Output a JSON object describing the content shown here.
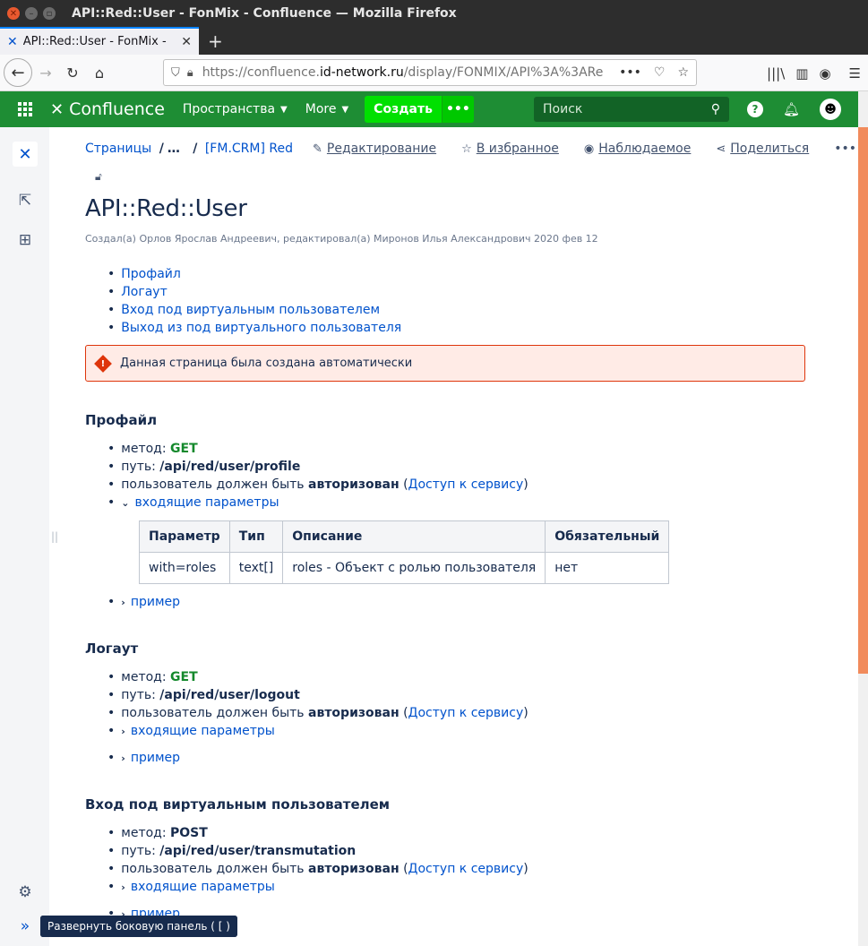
{
  "browser": {
    "window_title": "API::Red::User - FonMix - Confluence — Mozilla Firefox",
    "tab_title": "API::Red::User - FonMix - ",
    "url_prefix": "https://confluence.",
    "url_domain": "id-network.ru",
    "url_rest": "/display/FONMIX/API%3A%3ARe"
  },
  "header": {
    "logo_text": "Confluence",
    "spaces_label": "Пространства",
    "more_label": "More",
    "create_label": "Создать",
    "create_more": "•••",
    "search_placeholder": "Поиск",
    "help_icon": "?"
  },
  "breadcrumb": {
    "root": "Страницы",
    "ellipsis": "…",
    "parent": "[FM.CRM] Red"
  },
  "actions": {
    "edit": "Редактирование",
    "favorite": "В избранное",
    "watch": "Наблюдаемое",
    "share": "Поделиться",
    "more": "•••"
  },
  "page": {
    "title": "API::Red::User",
    "byline": "Создал(а) Орлов Ярослав Андреевич, редактировал(а) Миронов Илья Александрович 2020 фев 12",
    "toc": [
      "Профайл",
      "Логаут",
      "Вход под виртуальным пользователем",
      "Выход из под виртуального пользователя"
    ],
    "alert": "Данная страница была создана автоматически"
  },
  "labels": {
    "method": "метод:",
    "path": "путь:",
    "auth_prefix": "пользователь должен быть",
    "auth_bold": "авторизован",
    "auth_link": "Доступ к сервису",
    "params": "входящие параметры",
    "example": "пример"
  },
  "sections": [
    {
      "title": "Профайл",
      "method": "GET",
      "path": "/api/red/user/profile"
    },
    {
      "title": "Логаут",
      "method": "GET",
      "path": "/api/red/user/logout"
    },
    {
      "title": "Вход под виртуальным пользователем",
      "method": "POST",
      "path": "/api/red/user/transmutation"
    }
  ],
  "params_table": {
    "headers": [
      "Параметр",
      "Тип",
      "Описание",
      "Обязательный"
    ],
    "row": [
      "with=roles",
      "text[]",
      "roles - Объект с ролью пользователя",
      "нет"
    ]
  },
  "sidebar": {
    "tooltip": "Развернуть боковую панель ( [ )"
  }
}
